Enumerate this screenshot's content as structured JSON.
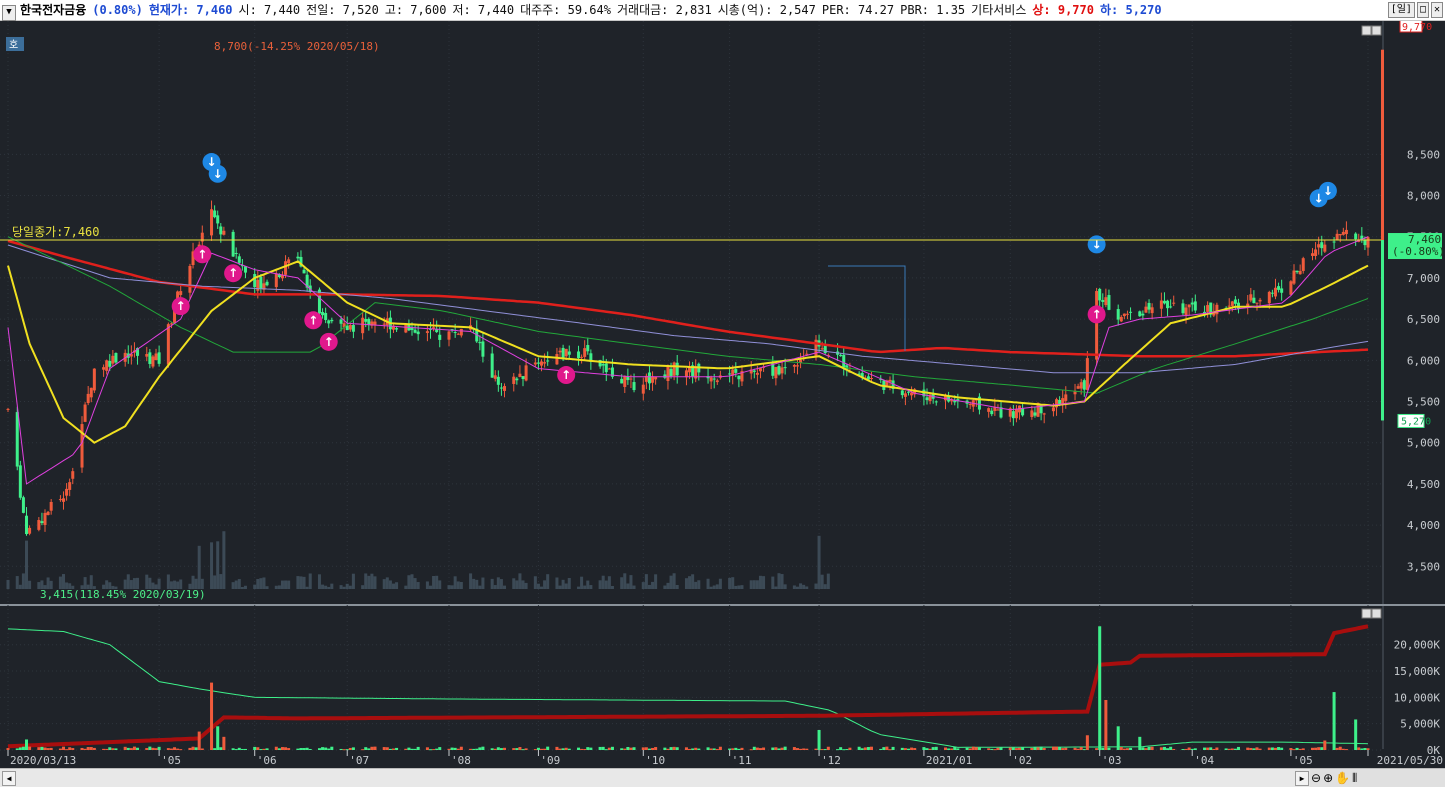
{
  "header": {
    "menu_icon": "chevron-down-icon",
    "name": "한국전자금융",
    "change": "(0.80%)",
    "current": "현재가: 7,460",
    "open": "시: 7,440",
    "prev": "전일: 7,520",
    "high": "고: 7,600",
    "low": "저: 7,440",
    "major": "대주주: 59.64%",
    "trade_amount": "거래대금: 2,831",
    "market_cap": "시총(억): 2,547",
    "per": "PER: 74.27",
    "pbr": "PBR: 1.35",
    "other": "기타서비스",
    "upper_limit": "상: 9,770",
    "lower_limit": "하: 5,270",
    "period_btn": "[일]"
  },
  "price_panel": {
    "side_label": "호",
    "close_line_label": "당일종가:7,460",
    "high_annotation": "8,700(-14.25% 2020/05/18)",
    "low_annotation": "3,415(118.45% 2020/03/19)",
    "upper_box": "9,770",
    "current_box": "7,460",
    "current_change_box": "(-0.80%)",
    "lower_box": "5,270",
    "y_ticks": [
      "8,500",
      "8,000",
      "7,500",
      "7,000",
      "6,500",
      "6,000",
      "5,500",
      "5,000",
      "4,500",
      "4,000",
      "3,500"
    ]
  },
  "volume_panel": {
    "y_ticks": [
      "20,000K",
      "15,000K",
      "10,000K",
      "5,000K",
      "0K"
    ]
  },
  "x_axis": {
    "labels": [
      "2020/03/13",
      "'05",
      "'06",
      "'07",
      "'08",
      "'09",
      "'10",
      "'11",
      "'12",
      "2021/01",
      "'02",
      "'03",
      "'04",
      "'05",
      "2021/05/30"
    ]
  },
  "colors": {
    "background": "#1f2329",
    "up": "#ef5b3c",
    "down": "#3ef08a",
    "ma5": "#e040e0",
    "ma20": "#f0e020",
    "ma60": "#22a83a",
    "ma120": "#9090d8",
    "ma240": "#e0201c"
  },
  "chart_data": {
    "type": "candlestick",
    "price_range": [
      3200,
      9900
    ],
    "volume_range": [
      0,
      24500
    ],
    "close_line": 7460,
    "price_anchors": [
      [
        "2020/03/13",
        5400
      ],
      [
        "2020/03/19",
        3900
      ],
      [
        "2020/04/01",
        4400
      ],
      [
        "2020/04/10",
        5900
      ],
      [
        "2020/04/20",
        6100
      ],
      [
        "2020/05/01",
        6000
      ],
      [
        "2020/05/08",
        6900
      ],
      [
        "2020/05/18",
        7800
      ],
      [
        "2020/05/25",
        7300
      ],
      [
        "2020/06/01",
        6900
      ],
      [
        "2020/06/10",
        7100
      ],
      [
        "2020/06/15",
        7300
      ],
      [
        "2020/06/22",
        6500
      ],
      [
        "2020/07/01",
        6400
      ],
      [
        "2020/07/10",
        6500
      ],
      [
        "2020/07/20",
        6400
      ],
      [
        "2020/08/01",
        6300
      ],
      [
        "2020/08/10",
        6400
      ],
      [
        "2020/08/20",
        5600
      ],
      [
        "2020/09/01",
        6000
      ],
      [
        "2020/09/15",
        6100
      ],
      [
        "2020/10/01",
        5700
      ],
      [
        "2020/10/15",
        5900
      ],
      [
        "2020/11/01",
        5800
      ],
      [
        "2020/11/20",
        5900
      ],
      [
        "2020/12/01",
        6200
      ],
      [
        "2020/12/15",
        5800
      ],
      [
        "2021/01/01",
        5600
      ],
      [
        "2021/01/15",
        5500
      ],
      [
        "2021/02/01",
        5350
      ],
      [
        "2021/02/15",
        5450
      ],
      [
        "2021/02/25",
        5700
      ],
      [
        "2021/03/01",
        6800
      ],
      [
        "2021/03/10",
        6500
      ],
      [
        "2021/03/20",
        6700
      ],
      [
        "2021/04/01",
        6600
      ],
      [
        "2021/04/15",
        6650
      ],
      [
        "2021/05/01",
        6900
      ],
      [
        "2021/05/10",
        7300
      ],
      [
        "2021/05/20",
        7600
      ],
      [
        "2021/05/28",
        7460
      ]
    ],
    "ma5_anchors": [
      [
        "2020/03/13",
        6400
      ],
      [
        "2020/03/19",
        4500
      ],
      [
        "2020/04/05",
        4900
      ],
      [
        "2020/04/15",
        5900
      ],
      [
        "2020/05/08",
        6500
      ],
      [
        "2020/05/18",
        7300
      ],
      [
        "2020/06/01",
        7100
      ],
      [
        "2020/06/15",
        7000
      ],
      [
        "2020/07/01",
        6450
      ],
      [
        "2020/08/10",
        6350
      ],
      [
        "2020/09/01",
        5900
      ],
      [
        "2020/10/01",
        5800
      ],
      [
        "2020/11/01",
        5800
      ],
      [
        "2020/12/01",
        6100
      ],
      [
        "2021/01/01",
        5600
      ],
      [
        "2021/02/01",
        5400
      ],
      [
        "2021/02/25",
        5500
      ],
      [
        "2021/03/05",
        6400
      ],
      [
        "2021/03/15",
        6500
      ],
      [
        "2021/04/01",
        6550
      ],
      [
        "2021/05/01",
        6700
      ],
      [
        "2021/05/15",
        7300
      ],
      [
        "2021/05/28",
        7500
      ]
    ],
    "ma20_anchors": [
      [
        "2020/03/13",
        7150
      ],
      [
        "2020/03/20",
        6200
      ],
      [
        "2020/03/31",
        5300
      ],
      [
        "2020/04/10",
        5000
      ],
      [
        "2020/04/20",
        5200
      ],
      [
        "2020/05/01",
        5800
      ],
      [
        "2020/05/18",
        6600
      ],
      [
        "2020/06/01",
        7000
      ],
      [
        "2020/06/15",
        7200
      ],
      [
        "2020/07/01",
        6700
      ],
      [
        "2020/07/15",
        6450
      ],
      [
        "2020/08/10",
        6400
      ],
      [
        "2020/09/01",
        6050
      ],
      [
        "2020/10/01",
        5950
      ],
      [
        "2020/11/01",
        5900
      ],
      [
        "2020/12/01",
        6050
      ],
      [
        "2020/12/20",
        5700
      ],
      [
        "2021/01/15",
        5550
      ],
      [
        "2021/02/15",
        5450
      ],
      [
        "2021/02/25",
        5500
      ],
      [
        "2021/03/10",
        5950
      ],
      [
        "2021/03/25",
        6450
      ],
      [
        "2021/04/15",
        6650
      ],
      [
        "2021/05/01",
        6650
      ],
      [
        "2021/05/15",
        6900
      ],
      [
        "2021/05/28",
        7150
      ]
    ],
    "ma60_anchors": [
      [
        "2020/03/13",
        7500
      ],
      [
        "2020/04/15",
        6900
      ],
      [
        "2020/05/08",
        6400
      ],
      [
        "2020/05/25",
        6100
      ],
      [
        "2020/06/20",
        6100
      ],
      [
        "2020/07/10",
        6700
      ],
      [
        "2020/08/01",
        6600
      ],
      [
        "2020/09/01",
        6350
      ],
      [
        "2020/10/01",
        6200
      ],
      [
        "2020/11/01",
        6050
      ],
      [
        "2020/12/01",
        5950
      ],
      [
        "2021/01/01",
        5800
      ],
      [
        "2021/02/01",
        5700
      ],
      [
        "2021/03/01",
        5600
      ],
      [
        "2021/03/20",
        5900
      ],
      [
        "2021/04/15",
        6200
      ],
      [
        "2021/05/10",
        6500
      ],
      [
        "2021/05/28",
        6750
      ]
    ],
    "ma120_anchors": [
      [
        "2020/03/13",
        7400
      ],
      [
        "2020/04/15",
        7000
      ],
      [
        "2020/05/15",
        6900
      ],
      [
        "2020/06/15",
        6850
      ],
      [
        "2020/07/15",
        6750
      ],
      [
        "2020/08/15",
        6600
      ],
      [
        "2020/09/15",
        6450
      ],
      [
        "2020/10/15",
        6300
      ],
      [
        "2020/11/15",
        6200
      ],
      [
        "2020/12/15",
        6050
      ],
      [
        "2021/01/15",
        5950
      ],
      [
        "2021/02/15",
        5850
      ],
      [
        "2021/03/15",
        5850
      ],
      [
        "2021/04/15",
        5950
      ],
      [
        "2021/05/15",
        6150
      ],
      [
        "2021/05/28",
        6230
      ]
    ],
    "ma240_anchors": [
      [
        "2020/03/13",
        7450
      ],
      [
        "2020/04/01",
        7250
      ],
      [
        "2020/05/01",
        6950
      ],
      [
        "2020/06/01",
        6800
      ],
      [
        "2020/07/01",
        6800
      ],
      [
        "2020/08/01",
        6780
      ],
      [
        "2020/09/01",
        6700
      ],
      [
        "2020/10/01",
        6550
      ],
      [
        "2020/11/01",
        6350
      ],
      [
        "2020/12/01",
        6200
      ],
      [
        "2020/12/20",
        6100
      ],
      [
        "2021/01/10",
        6150
      ],
      [
        "2021/02/01",
        6100
      ],
      [
        "2021/03/15",
        6050
      ],
      [
        "2021/04/15",
        6050
      ],
      [
        "2021/05/28",
        6130
      ]
    ],
    "volume_spikes": [
      [
        "2020/03/19",
        2000
      ],
      [
        "2020/05/14",
        3500
      ],
      [
        "2020/05/18",
        12800
      ],
      [
        "2020/05/20",
        4500
      ],
      [
        "2020/05/22",
        2500
      ],
      [
        "2020/12/01",
        3800
      ],
      [
        "2021/02/26",
        2800
      ],
      [
        "2021/03/02",
        23500
      ],
      [
        "2021/03/04",
        9500
      ],
      [
        "2021/03/08",
        4500
      ],
      [
        "2021/03/15",
        2500
      ],
      [
        "2021/05/14",
        1800
      ],
      [
        "2021/05/17",
        11000
      ],
      [
        "2021/05/24",
        5800
      ]
    ],
    "cum_volume_anchors": [
      [
        "2020/03/13",
        700
      ],
      [
        "2020/05/14",
        2200
      ],
      [
        "2020/05/18",
        4200
      ],
      [
        "2020/05/22",
        6200
      ],
      [
        "2020/06/15",
        6000
      ],
      [
        "2020/12/01",
        6500
      ],
      [
        "2021/02/26",
        7300
      ],
      [
        "2021/03/02",
        16200
      ],
      [
        "2021/03/12",
        16600
      ],
      [
        "2021/03/15",
        17900
      ],
      [
        "2021/05/14",
        18200
      ],
      [
        "2021/05/17",
        22200
      ],
      [
        "2021/05/28",
        23500
      ]
    ],
    "green_line_anchors": [
      [
        "2020/03/13",
        23000
      ],
      [
        "2020/03/31",
        22500
      ],
      [
        "2020/04/15",
        20000
      ],
      [
        "2020/05/01",
        13000
      ],
      [
        "2020/05/15",
        11500
      ],
      [
        "2020/06/01",
        10000
      ],
      [
        "2020/08/01",
        9700
      ],
      [
        "2020/11/20",
        9300
      ],
      [
        "2020/12/05",
        7500
      ],
      [
        "2020/12/20",
        3000
      ],
      [
        "2021/01/15",
        500
      ],
      [
        "2021/03/15",
        600
      ],
      [
        "2021/04/01",
        1500
      ],
      [
        "2021/05/01",
        1500
      ],
      [
        "2021/05/28",
        1200
      ]
    ],
    "buy_signals": [
      "2020/05/08",
      "2020/05/15",
      "2020/05/25",
      "2020/06/20",
      "2020/06/25",
      "2020/09/10",
      "2021/03/01"
    ],
    "sell_signals": [
      "2020/05/18",
      "2020/05/20",
      "2021/03/01",
      "2021/05/12",
      "2021/05/15"
    ]
  }
}
